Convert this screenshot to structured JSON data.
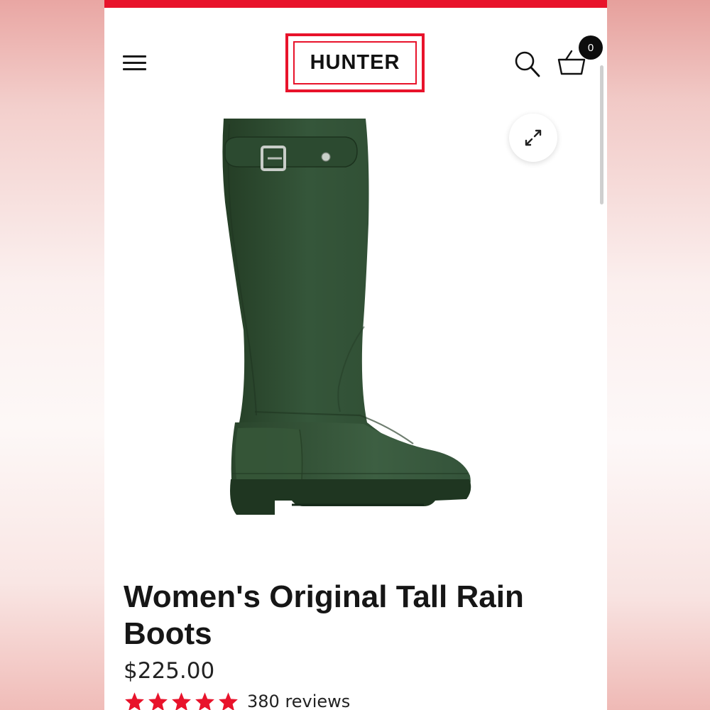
{
  "header": {
    "brand": "HUNTER",
    "cart_count": "0"
  },
  "icons": {
    "menu": "hamburger-menu-icon",
    "search": "search-icon",
    "cart": "basket-icon",
    "expand": "expand-icon",
    "star": "star-icon"
  },
  "colors": {
    "brand_red": "#e8132b",
    "boot_green": "#2f4c2f",
    "star_red": "#e8132b",
    "text_dark": "#161616"
  },
  "product": {
    "title": "Women's Original Tall Rain Boots",
    "price": "$225.00",
    "rating": 5,
    "rating_max": 5,
    "reviews": "380 reviews"
  }
}
